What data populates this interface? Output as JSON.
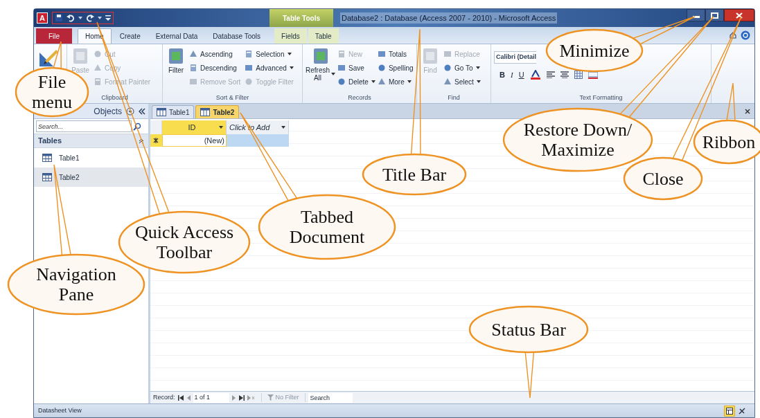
{
  "title_bar": {
    "app_icon": "A",
    "contextual_group": "Table Tools",
    "title": "Database2 : Database (Access 2007 - 2010) - Microsoft Access"
  },
  "tabs": [
    {
      "label": "File",
      "kind": "file",
      "selected": false
    },
    {
      "label": "Home",
      "kind": "tab",
      "selected": true
    },
    {
      "label": "Create",
      "kind": "tab",
      "selected": false
    },
    {
      "label": "External Data",
      "kind": "tab",
      "selected": false
    },
    {
      "label": "Database Tools",
      "kind": "tab",
      "selected": false
    },
    {
      "label": "Fields",
      "kind": "contextual",
      "selected": false
    },
    {
      "label": "Table",
      "kind": "contextual",
      "selected": false
    }
  ],
  "ribbon": {
    "groups": [
      {
        "kind": "views"
      },
      {
        "kind": "commands",
        "label": "Clipboard",
        "large": {
          "label": "Paste",
          "disabled": true,
          "dropdown": false
        },
        "columns": [
          [
            {
              "label": "Cut",
              "disabled": true,
              "dropdown": false
            },
            {
              "label": "Copy",
              "disabled": true,
              "dropdown": false
            },
            {
              "label": "Format Painter",
              "disabled": true,
              "dropdown": false
            }
          ]
        ]
      },
      {
        "kind": "commands",
        "label": "Sort & Filter",
        "large": {
          "label": "Filter",
          "disabled": false,
          "dropdown": false
        },
        "columns": [
          [
            {
              "label": "Ascending",
              "disabled": false,
              "dropdown": false
            },
            {
              "label": "Descending",
              "disabled": false,
              "dropdown": false
            },
            {
              "label": "Remove Sort",
              "disabled": true,
              "dropdown": false
            }
          ],
          [
            {
              "label": "Selection",
              "disabled": false,
              "dropdown": true
            },
            {
              "label": "Advanced",
              "disabled": false,
              "dropdown": true
            },
            {
              "label": "Toggle Filter",
              "disabled": true,
              "dropdown": false
            }
          ]
        ]
      },
      {
        "kind": "commands",
        "label": "Records",
        "large": {
          "label": "Refresh\nAll",
          "disabled": false,
          "dropdown": true
        },
        "columns": [
          [
            {
              "label": "New",
              "disabled": true,
              "dropdown": false
            },
            {
              "label": "Save",
              "disabled": false,
              "dropdown": false
            },
            {
              "label": "Delete",
              "disabled": false,
              "dropdown": true
            }
          ],
          [
            {
              "label": "Totals",
              "disabled": false,
              "dropdown": false
            },
            {
              "label": "Spelling",
              "disabled": false,
              "dropdown": false
            },
            {
              "label": "More",
              "disabled": false,
              "dropdown": true
            }
          ]
        ]
      },
      {
        "kind": "commands",
        "label": "Find",
        "large": {
          "label": "Find",
          "disabled": true,
          "dropdown": false
        },
        "columns": [
          [
            {
              "label": "Replace",
              "disabled": true,
              "dropdown": false
            },
            {
              "label": "Go To",
              "disabled": false,
              "dropdown": true
            },
            {
              "label": "Select",
              "disabled": false,
              "dropdown": true
            }
          ]
        ]
      },
      {
        "kind": "formatting",
        "label": "Text Formatting",
        "font": "Calibri (Detail",
        "format_buttons": [
          "B",
          "I",
          "U"
        ]
      }
    ]
  },
  "navigation_pane": {
    "header": "Objects",
    "search": {
      "placeholder": "Search..."
    },
    "sections": [
      {
        "label": "Tables",
        "expanded": true,
        "items": [
          {
            "label": "Table1",
            "selected": false
          },
          {
            "label": "Table2",
            "selected": true
          }
        ]
      }
    ]
  },
  "document_tabs": [
    {
      "label": "Table1",
      "selected": false
    },
    {
      "label": "Table2",
      "selected": true
    }
  ],
  "datasheet": {
    "columns": [
      {
        "label": "ID",
        "selected": true
      },
      {
        "label": "Click to Add",
        "selected": false
      }
    ],
    "new_row": [
      "(New)"
    ]
  },
  "record_navigator": {
    "label": "Record:",
    "position": "1 of 1",
    "filter": "No Filter",
    "search": {
      "placeholder": "Search"
    }
  },
  "status_bar": {
    "text": "Datasheet View",
    "views": [
      {
        "selected": true
      },
      {
        "selected": false
      }
    ]
  },
  "callouts": [
    {
      "text": "File\nmenu"
    },
    {
      "text": "Quick Access\nToolbar"
    },
    {
      "text": "Navigation\nPane"
    },
    {
      "text": "Tabbed\nDocument"
    },
    {
      "text": "Title Bar"
    },
    {
      "text": "Minimize"
    },
    {
      "text": "Restore Down/\nMaximize"
    },
    {
      "text": "Close"
    },
    {
      "text": "Ribbon"
    },
    {
      "text": "Status Bar"
    }
  ]
}
